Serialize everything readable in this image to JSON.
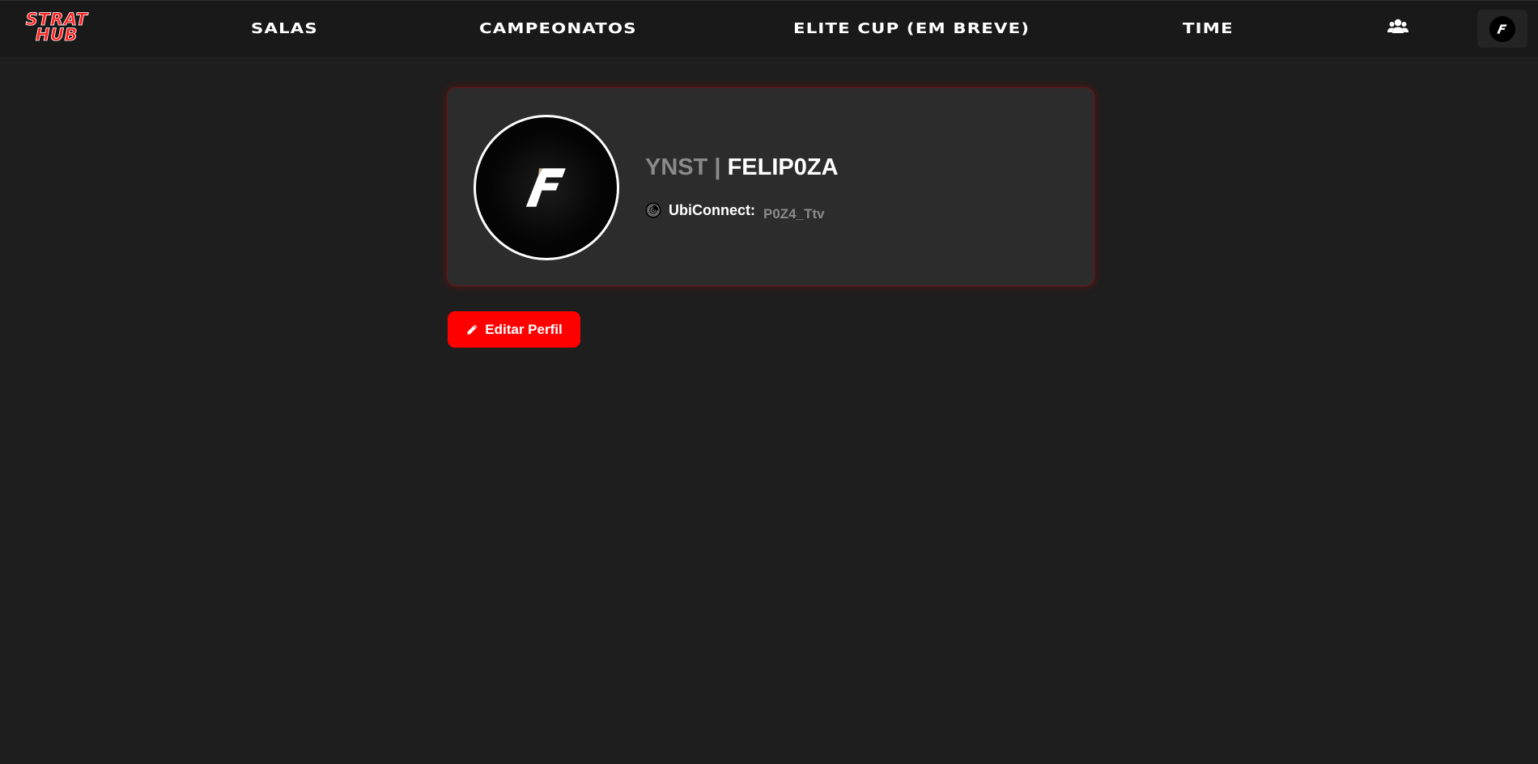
{
  "logo": {
    "line1": "STRAT",
    "line2": "HUB"
  },
  "nav": {
    "items": [
      {
        "label": "SALAS"
      },
      {
        "label": "CAMPEONATOS"
      },
      {
        "label": "ELITE CUP (EM BREVE)"
      },
      {
        "label": "TIME"
      }
    ],
    "friends_icon": "users-icon",
    "avatar_icon": "f-logo-avatar"
  },
  "profile": {
    "team_tag": "YNST",
    "separator": " | ",
    "nickname": "FELIP0ZA",
    "ubiconnect_icon": "ubisoft-swirl-icon",
    "ubiconnect_label": "UbiConnect:",
    "ubiconnect_value": "P0Z4_Ttv"
  },
  "actions": {
    "edit_icon": "pencil-icon",
    "edit_label": "Editar Perfil"
  },
  "colors": {
    "background": "#1e1e1e",
    "topbar": "#191919",
    "card": "#2c2c2c",
    "accent": "#ff0000",
    "muted_text": "#8a8a8a"
  }
}
